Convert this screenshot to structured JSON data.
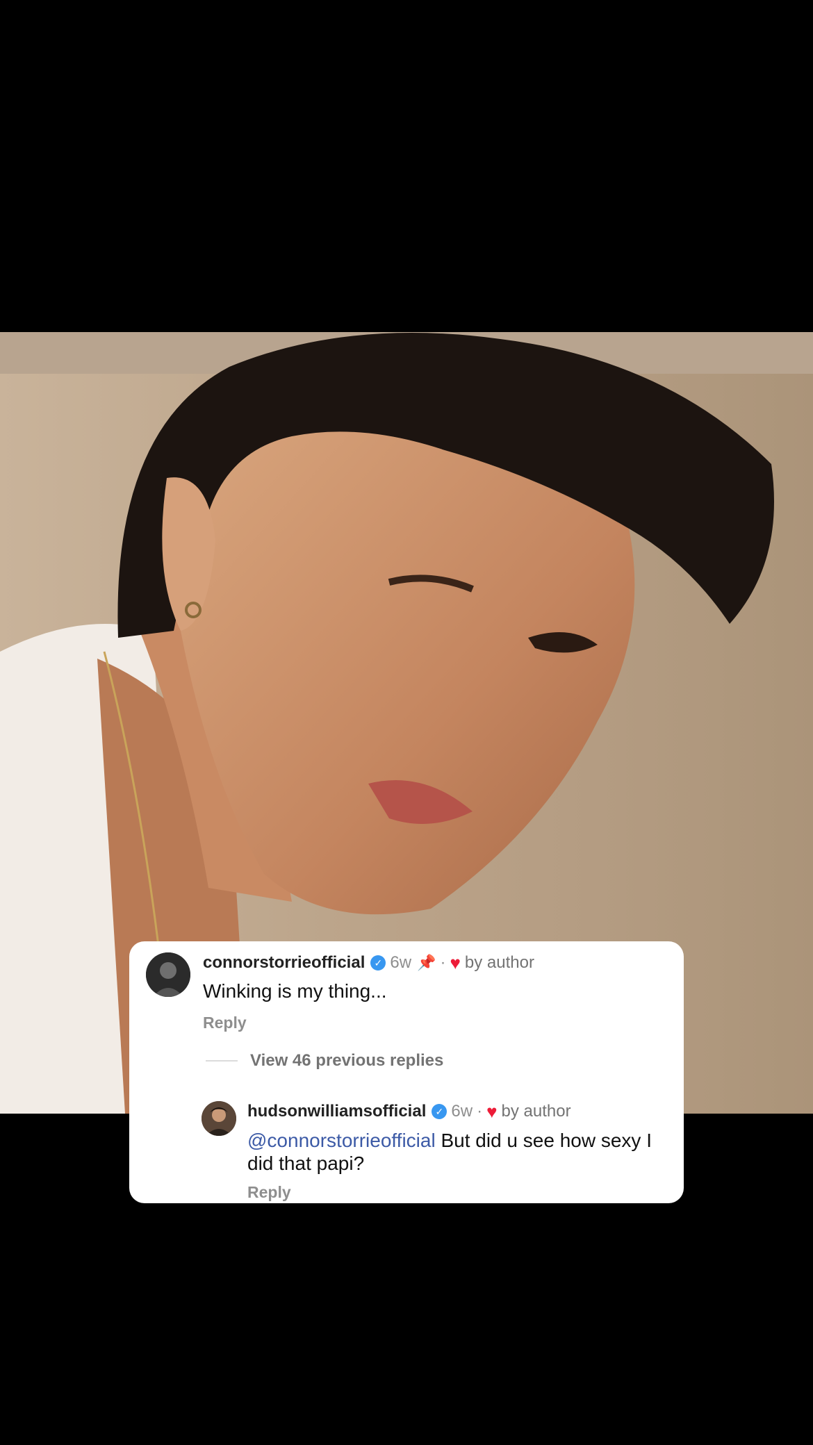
{
  "photo": {
    "description_icon": "portrait-photo"
  },
  "comment": {
    "username": "connorstorrieofficial",
    "time": "6w",
    "dot": "·",
    "by_author": "by author",
    "text": "Winking is my thing...",
    "reply_label": "Reply"
  },
  "view_previous": "View 46 previous replies",
  "reply": {
    "username": "hudsonwilliamsofficial",
    "time": "6w",
    "dot": "·",
    "by_author": "by author",
    "mention": "@connorstorrieofficial",
    "text": " But did u see how sexy I did that papi?",
    "reply_label": "Reply"
  },
  "colors": {
    "verified": "#3897f0",
    "heart": "#ed1c38",
    "mention": "#3c5aa6"
  }
}
